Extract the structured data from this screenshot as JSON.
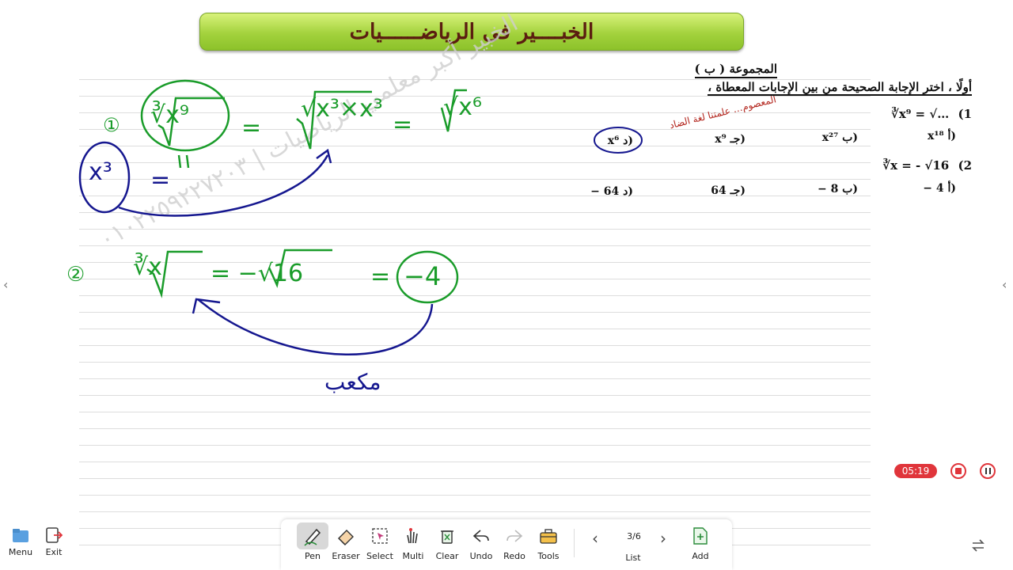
{
  "banner": {
    "title": "الخبــــير فى الرياضــــــيات"
  },
  "worksheet": {
    "group": "المجموعة ( ب )",
    "instruction": "أولًا ، اختر الإجابة الصحيحة من بين الإجابات المعطاة ،",
    "q1": {
      "number": "1)",
      "text": "∛x⁹ = √…"
    },
    "q1_options": [
      "(أ x¹⁸",
      "(ب x²⁷",
      "(جـ x⁹",
      "(د x⁶"
    ],
    "q2": {
      "number": "2)",
      "text": "∛x = - √16"
    },
    "q2_options": [
      "(أ 4 −",
      "(ب 8 −",
      "(جـ 64",
      "(د 64 −"
    ],
    "red_note": "المعصوم… علمتنا لغة الضاد"
  },
  "handwriting": {
    "circle1": "①",
    "eq1_left": "∛x⁹",
    "eq1_mid": "√x³×x³",
    "eq1_right": "√x⁶",
    "equals": "=",
    "result1": "x³",
    "circle2": "②",
    "eq2_left": "∛x",
    "eq2_mid": "= −√16",
    "eq2_right": "−4",
    "cube_note": "مكعب"
  },
  "watermark": "الخبير أكبر معلمي الرياضيات | ٠١٠٢٢٥٩٢٢٧٢٠٣",
  "recorder": {
    "time": "05:19"
  },
  "toolbar": {
    "left": [
      {
        "label": "Menu"
      },
      {
        "label": "Exit"
      }
    ],
    "tools": [
      {
        "label": "Pen"
      },
      {
        "label": "Eraser"
      },
      {
        "label": "Select"
      },
      {
        "label": "Multi"
      },
      {
        "label": "Clear"
      },
      {
        "label": "Undo"
      },
      {
        "label": "Redo"
      },
      {
        "label": "Tools"
      }
    ],
    "page": "3/6",
    "list_label": "List",
    "add_label": "Add"
  },
  "colors": {
    "green_ink": "#1a9c2a",
    "blue_ink": "#15178f",
    "banner_green": "#a3d23d",
    "record_red": "#e0353b"
  }
}
